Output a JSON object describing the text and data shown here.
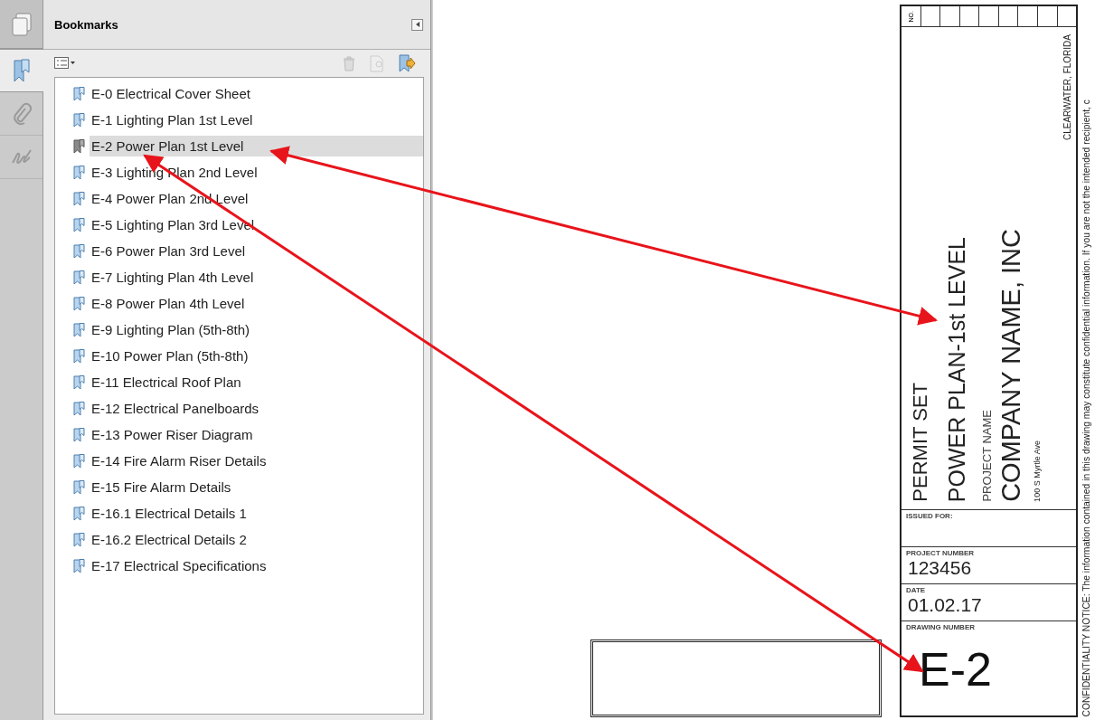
{
  "nav_tabs": [
    {
      "kind": "pages",
      "selected": false
    },
    {
      "kind": "bookmarks",
      "selected": true
    },
    {
      "kind": "attachments",
      "selected": false
    },
    {
      "kind": "signatures",
      "selected": false
    }
  ],
  "bookmarks": {
    "title": "Bookmarks",
    "items": [
      {
        "label": "E-0 Electrical Cover Sheet",
        "selected": false
      },
      {
        "label": "E-1 Lighting Plan 1st Level",
        "selected": false
      },
      {
        "label": "E-2 Power Plan 1st Level",
        "selected": true
      },
      {
        "label": "E-3 Lighting Plan 2nd Level",
        "selected": false
      },
      {
        "label": "E-4 Power Plan 2nd Level",
        "selected": false
      },
      {
        "label": "E-5 Lighting Plan 3rd Level",
        "selected": false
      },
      {
        "label": "E-6 Power Plan 3rd Level",
        "selected": false
      },
      {
        "label": "E-7 Lighting Plan 4th Level",
        "selected": false
      },
      {
        "label": "E-8 Power Plan 4th Level",
        "selected": false
      },
      {
        "label": "E-9 Lighting Plan (5th-8th)",
        "selected": false
      },
      {
        "label": "E-10 Power Plan (5th-8th)",
        "selected": false
      },
      {
        "label": "E-11 Electrical Roof Plan",
        "selected": false
      },
      {
        "label": "E-12 Electrical Panelboards",
        "selected": false
      },
      {
        "label": "E-13 Power Riser Diagram",
        "selected": false
      },
      {
        "label": "E-14 Fire Alarm Riser Details",
        "selected": false
      },
      {
        "label": "E-15 Fire Alarm Details",
        "selected": false
      },
      {
        "label": "E-16.1 Electrical Details 1",
        "selected": false
      },
      {
        "label": "E-16.2 Electrical Details 2",
        "selected": false
      },
      {
        "label": "E-17 Electrical Specifications",
        "selected": false
      }
    ]
  },
  "title_block": {
    "revision_header": "NO.",
    "stage": "PERMIT SET",
    "sheet_title": "POWER  PLAN-1st  LEVEL",
    "project_label": "PROJECT NAME",
    "company": "COMPANY NAME, INC",
    "address": "100 S Myrtle Ave",
    "location": "CLEARWATER,  FLORIDA",
    "fields": [
      {
        "kind": "field",
        "label": "ISSUED FOR:"
      },
      {
        "kind": "field",
        "label": "PROJECT NUMBER",
        "value": "123456"
      },
      {
        "kind": "field",
        "label": "DATE",
        "value": "01.02.17"
      },
      {
        "kind": "drawing_number",
        "label": "DRAWING NUMBER",
        "value": "E-2"
      }
    ],
    "notice": "CONFIDENTIALITY  NOTICE: The information contained in this drawing may constitute confidential information.  If you are not the intended recipient, c"
  }
}
